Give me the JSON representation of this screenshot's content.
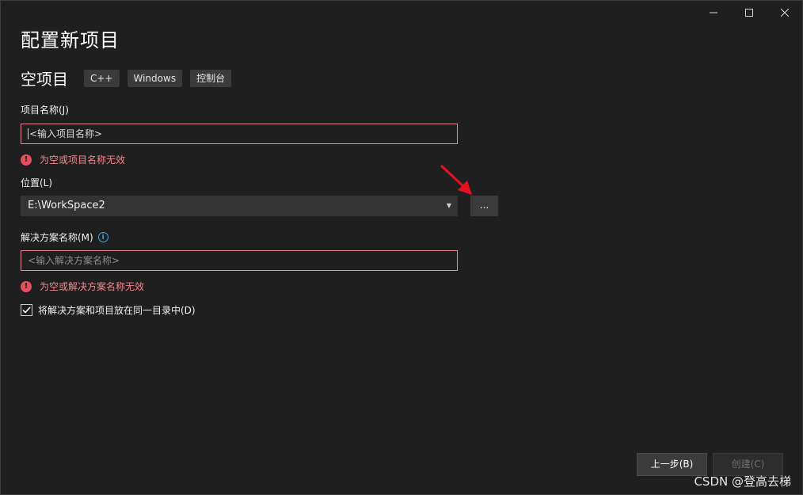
{
  "window": {
    "controls": {
      "minimize_icon": "minimize-icon",
      "maximize_icon": "maximize-icon",
      "close_icon": "close-icon"
    }
  },
  "page_title": "配置新项目",
  "template": {
    "name": "空项目",
    "tags": [
      "C++",
      "Windows",
      "控制台"
    ]
  },
  "project_name": {
    "label": "项目名称(J)",
    "placeholder": "<输入项目名称>",
    "error": "为空或项目名称无效"
  },
  "location": {
    "label": "位置(L)",
    "value": "E:\\WorkSpace2",
    "browse_label": "..."
  },
  "solution_name": {
    "label": "解决方案名称(M)",
    "placeholder": "<输入解决方案名称>",
    "error": "为空或解决方案名称无效"
  },
  "same_dir": {
    "label": "将解决方案和项目放在同一目录中(D)",
    "checked": true
  },
  "footer": {
    "back_label": "上一步(B)",
    "create_label": "创建(C)"
  },
  "watermark": "CSDN @登高去梯",
  "colors": {
    "background": "#1f1f1f",
    "error": "#f48591",
    "input_error_border": "#e58b96",
    "annotation_arrow": "#e81123",
    "info": "#3fa6e6"
  }
}
